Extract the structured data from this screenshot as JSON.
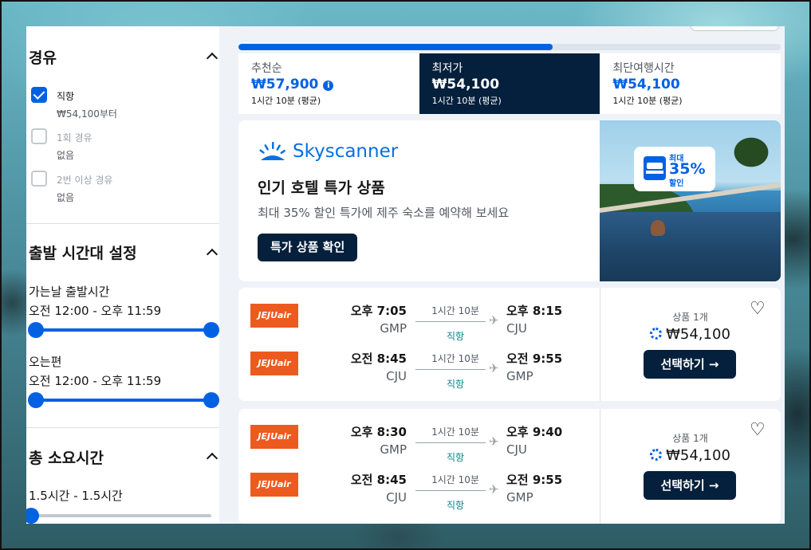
{
  "sidebar": {
    "stops": {
      "title": "경유",
      "options": [
        {
          "label": "직항",
          "sub": "₩54,100부터",
          "checked": true
        },
        {
          "label": "1회 경유",
          "sub": "없음",
          "checked": false
        },
        {
          "label": "2번 이상 경유",
          "sub": "없음",
          "checked": false
        }
      ]
    },
    "departure": {
      "title": "출발 시간대 설정",
      "outbound_label": "가는날 출발시간",
      "outbound_range": "오전 12:00 - 오후 11:59",
      "inbound_label": "오는편",
      "inbound_range": "오전 12:00 - 오후 11:59"
    },
    "duration": {
      "title": "총 소요시간",
      "range": "1.5시간 - 1.5시간"
    }
  },
  "progress": {
    "fraction": 0.58
  },
  "sort_tabs": [
    {
      "label": "추천순",
      "price": "₩57,900",
      "duration": "1시간 10분 (평균)",
      "active": false,
      "info": "i"
    },
    {
      "label": "최저가",
      "price": "₩54,100",
      "duration": "1시간 10분 (평균)",
      "active": true
    },
    {
      "label": "최단여행시간",
      "price": "₩54,100",
      "duration": "1시간 10분 (평균)",
      "active": false
    }
  ],
  "ad": {
    "brand": "Skyscanner",
    "title": "인기 호텔 특가 상품",
    "subtitle": "최대 35% 할인 특가에 제주 숙소를 예약해 보세요",
    "button": "특가 상품 확인",
    "badge_small_top": "최대",
    "badge_big": "35%",
    "badge_small_bottom": "할인"
  },
  "results": [
    {
      "legs": [
        {
          "airline": "JEJUair",
          "dep_time": "오후 7:05",
          "dep_code": "GMP",
          "duration": "1시간 10분",
          "stops": "직항",
          "arr_time": "오후 8:15",
          "arr_code": "CJU"
        },
        {
          "airline": "JEJUair",
          "dep_time": "오전 8:45",
          "dep_code": "CJU",
          "duration": "1시간 10분",
          "stops": "직항",
          "arr_time": "오전 9:55",
          "arr_code": "GMP"
        }
      ],
      "offers": "상품 1개",
      "price": "₩54,100",
      "select": "선택하기 →"
    },
    {
      "legs": [
        {
          "airline": "JEJUair",
          "dep_time": "오후 8:30",
          "dep_code": "GMP",
          "duration": "1시간 10분",
          "stops": "직항",
          "arr_time": "오후 9:40",
          "arr_code": "CJU"
        },
        {
          "airline": "JEJUair",
          "dep_time": "오전 8:45",
          "dep_code": "CJU",
          "duration": "1시간 10분",
          "stops": "직항",
          "arr_time": "오전 9:55",
          "arr_code": "GMP"
        }
      ],
      "offers": "상품 1개",
      "price": "₩54,100",
      "select": "선택하기 →"
    }
  ],
  "colors": {
    "accent": "#0062e3",
    "navy": "#05203c",
    "airline": "#ed5a1f",
    "direct": "#0c838a"
  },
  "icons": {
    "info": "info-icon",
    "heart": "heart-icon",
    "plane": "plane-icon",
    "chevron": "chevron-up-icon",
    "spinner": "loading-icon",
    "hotel": "bed-icon"
  }
}
